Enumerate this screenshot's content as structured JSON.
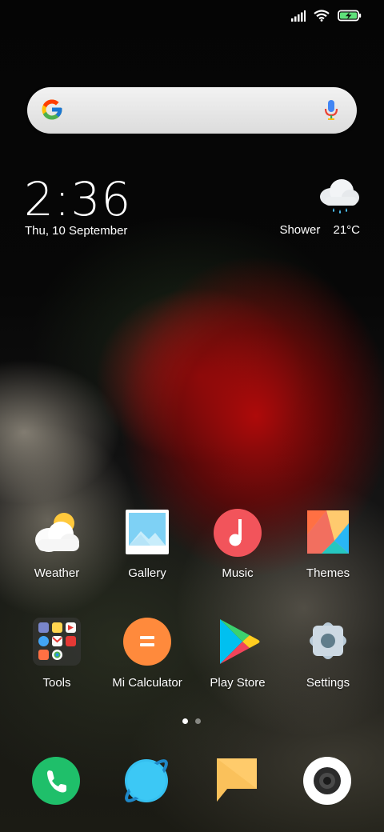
{
  "status_bar": {
    "icons": [
      "signal-icon",
      "wifi-icon",
      "battery-charging-icon"
    ]
  },
  "search": {
    "placeholder": "",
    "icons": [
      "google-g-icon",
      "microphone-icon"
    ]
  },
  "clock": {
    "time": "2:36",
    "date": "Thu, 10 September"
  },
  "weather": {
    "condition": "Shower",
    "temperature": "21°C",
    "icon": "rain-cloud-icon"
  },
  "apps_row1": [
    {
      "label": "Weather",
      "icon": "weather-app-icon"
    },
    {
      "label": "Gallery",
      "icon": "gallery-app-icon"
    },
    {
      "label": "Music",
      "icon": "music-app-icon"
    },
    {
      "label": "Themes",
      "icon": "themes-app-icon"
    }
  ],
  "apps_row2": [
    {
      "label": "Tools",
      "icon": "tools-folder-icon"
    },
    {
      "label": "Mi Calculator",
      "icon": "calculator-app-icon"
    },
    {
      "label": "Play Store",
      "icon": "play-store-icon"
    },
    {
      "label": "Settings",
      "icon": "settings-app-icon"
    }
  ],
  "page_indicator": {
    "pages": 2,
    "current": 1
  },
  "dock": [
    {
      "icon": "phone-icon"
    },
    {
      "icon": "browser-icon"
    },
    {
      "icon": "messages-icon"
    },
    {
      "icon": "camera-icon"
    }
  ],
  "colors": {
    "phone": "#1fbf6a",
    "browser": "#36c0f0",
    "messages": "#ffcb6b",
    "calculator": "#ff8a3c",
    "music": "#f2545b"
  }
}
